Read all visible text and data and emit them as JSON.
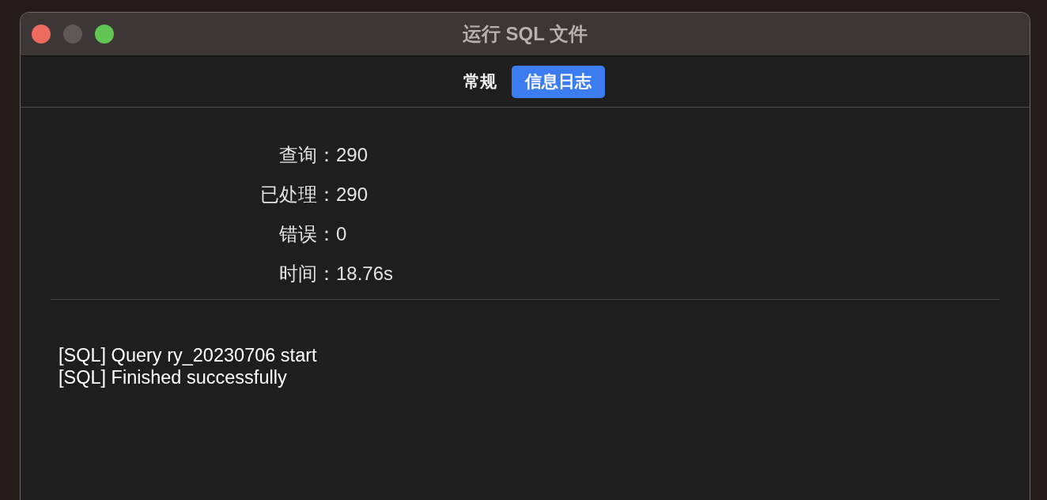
{
  "window": {
    "title": "运行 SQL 文件",
    "controls": [
      {
        "kind": "close",
        "disabled": false
      },
      {
        "kind": "minimize",
        "disabled": true
      },
      {
        "kind": "zoom",
        "disabled": false
      }
    ]
  },
  "tabs": [
    {
      "label": "常规",
      "selected": false
    },
    {
      "label": "信息日志",
      "selected": true
    }
  ],
  "stats": [
    {
      "label": "查询：",
      "value": "290"
    },
    {
      "label": "已处理：",
      "value": "290"
    },
    {
      "label": "错误：",
      "value": "0"
    },
    {
      "label": "时间：",
      "value": "18.76s"
    }
  ],
  "log": [
    "[SQL] Query ry_20230706 start",
    "[SQL] Finished successfully"
  ]
}
